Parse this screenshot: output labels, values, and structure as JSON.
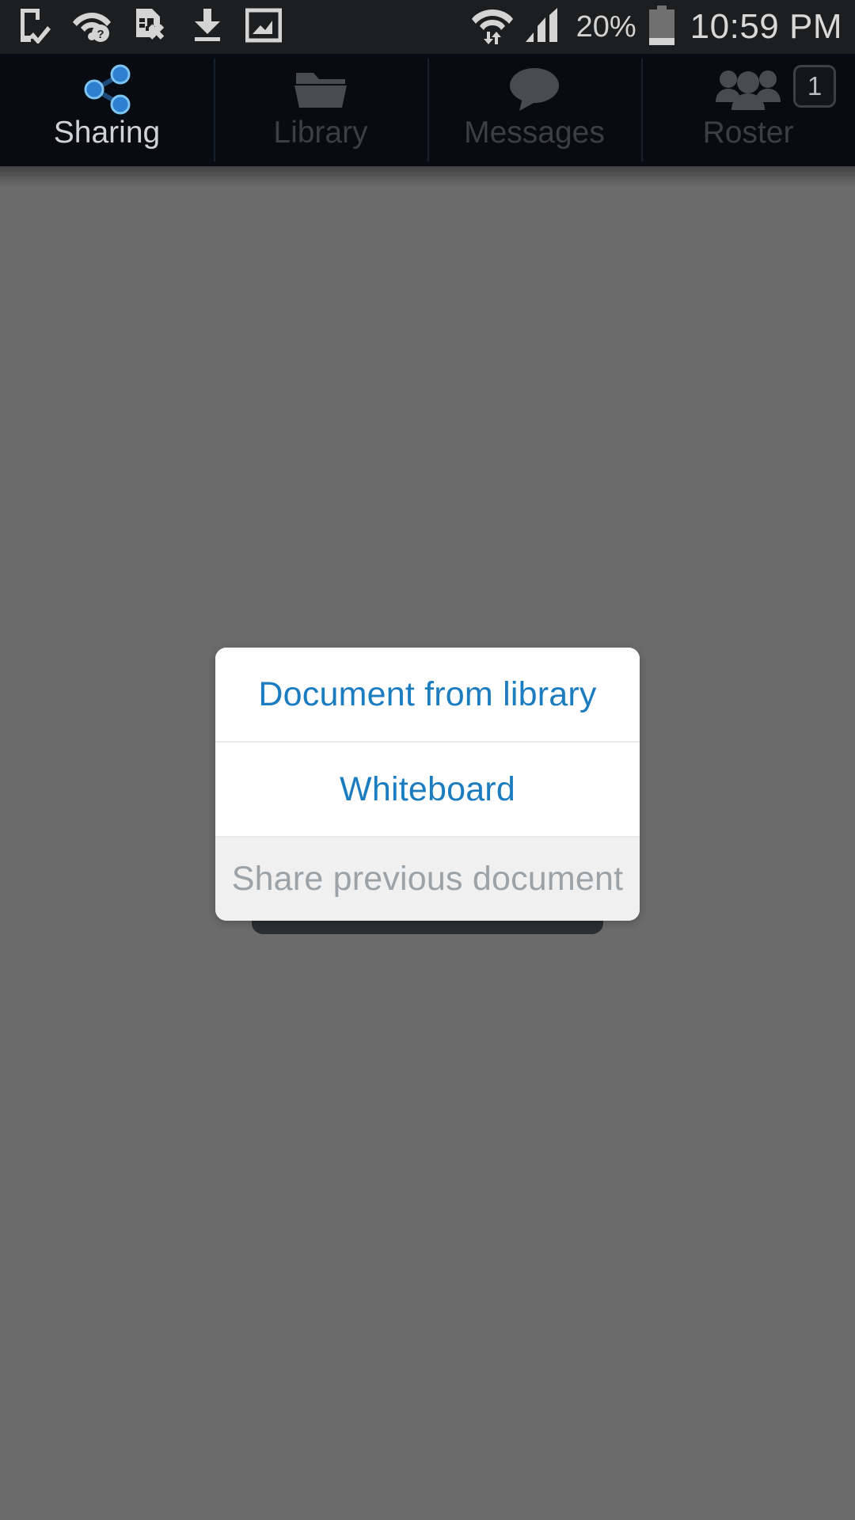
{
  "status_bar": {
    "battery_percent": "20%",
    "clock": "10:59 PM",
    "left_icons": [
      {
        "name": "device-check-icon",
        "label": "device synced"
      },
      {
        "name": "wifi-question-icon",
        "label": "wifi unknown"
      },
      {
        "name": "sim-card-error-icon",
        "label": "sim card error"
      },
      {
        "name": "download-icon",
        "label": "download complete"
      },
      {
        "name": "image-saved-icon",
        "label": "screenshot saved"
      }
    ],
    "right_icons": [
      {
        "name": "wifi-transfer-icon",
        "label": "wifi data transfer"
      },
      {
        "name": "cellular-signal-icon",
        "label": "cellular signal"
      },
      {
        "name": "battery-icon",
        "label": "battery low"
      }
    ]
  },
  "tabs": [
    {
      "label": "Sharing",
      "icon": "share-nodes-icon",
      "active": true,
      "badge": null
    },
    {
      "label": "Library",
      "icon": "folder-icon",
      "active": false,
      "badge": null
    },
    {
      "label": "Messages",
      "icon": "speech-bubble-icon",
      "active": false,
      "badge": null
    },
    {
      "label": "Roster",
      "icon": "people-group-icon",
      "active": false,
      "badge": "1"
    }
  ],
  "dialog": {
    "options": [
      {
        "label": "Document from library",
        "enabled": true
      },
      {
        "label": "Whiteboard",
        "enabled": true
      },
      {
        "label": "Share previous document",
        "enabled": false
      }
    ]
  },
  "colors": {
    "accent_blue": "#1b7cc0",
    "disabled_text": "#9ba3a9",
    "scrim": "#6b6b6b",
    "tab_bar_bg": "#080c12",
    "status_bar_bg": "#1c1e1f",
    "active_tab_icon": "#2f7fd0"
  }
}
